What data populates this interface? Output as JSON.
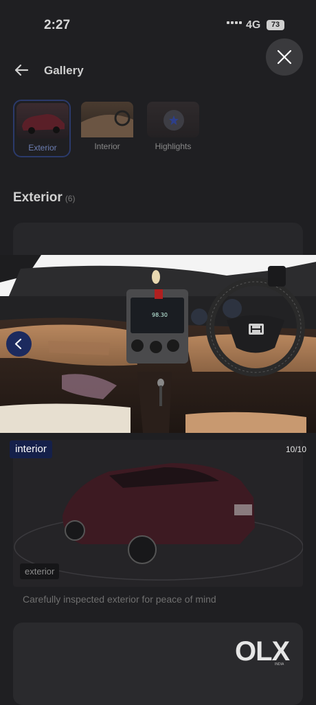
{
  "status_bar": {
    "time": "2:27",
    "network": "4G",
    "battery": "73"
  },
  "header": {
    "title": "Gallery",
    "back_icon": "arrow-left-icon",
    "close_icon": "close-icon"
  },
  "tabs": [
    {
      "label": "Exterior",
      "active": true
    },
    {
      "label": "Interior",
      "active": false
    },
    {
      "label": "Highlights",
      "active": false
    }
  ],
  "section": {
    "title": "Exterior",
    "count": "(6)"
  },
  "viewer": {
    "caption": "interior",
    "counter": "10/10",
    "prev_icon": "chevron-left-icon",
    "radio_display": "98.30"
  },
  "background_card": {
    "tag": "exterior",
    "description": "Carefully inspected exterior for peace of mind"
  },
  "brand": {
    "logo": "OLX",
    "sub": "INDIA"
  },
  "colors": {
    "accent": "#1c2a5e",
    "caption_bg": "#15204a"
  }
}
